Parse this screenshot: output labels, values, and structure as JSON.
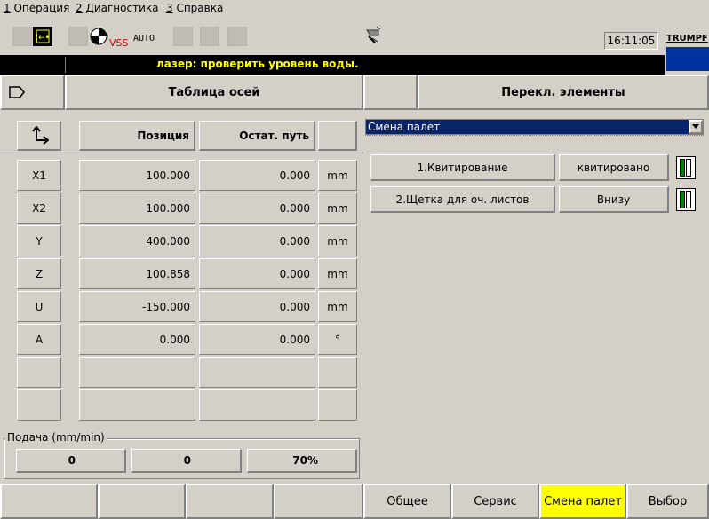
{
  "menu": {
    "items": [
      {
        "num": "1",
        "label": " Операция"
      },
      {
        "num": "2",
        "label": " Диагностика"
      },
      {
        "num": "3",
        "label": " Справка"
      }
    ]
  },
  "toolbar": {
    "vss_label": "VSS",
    "auto_label": "AUTO",
    "clock": "16:11:05",
    "brand": "TRUMPF",
    "message": "лазер: проверить уровень воды."
  },
  "left_panel": {
    "title": "Таблица осей",
    "col_position": "Позиция",
    "col_remaining": "Остат. путь",
    "axes": [
      {
        "name": "X1",
        "position": "100.000",
        "remaining": "0.000",
        "unit": "mm"
      },
      {
        "name": "X2",
        "position": "100.000",
        "remaining": "0.000",
        "unit": "mm"
      },
      {
        "name": "Y",
        "position": "400.000",
        "remaining": "0.000",
        "unit": "mm"
      },
      {
        "name": "Z",
        "position": "100.858",
        "remaining": "0.000",
        "unit": "mm"
      },
      {
        "name": "U",
        "position": "-150.000",
        "remaining": "0.000",
        "unit": "mm"
      },
      {
        "name": "A",
        "position": "0.000",
        "remaining": "0.000",
        "unit": "°"
      }
    ],
    "feed_label": "Подача (mm/min)",
    "feed_values": [
      "0",
      "0",
      "70%"
    ]
  },
  "right_panel": {
    "title": "Перекл. элементы",
    "dropdown_value": "Смена палет",
    "rows": [
      {
        "button": "1.Квитирование",
        "status": "квитировано"
      },
      {
        "button": "2.Щетка для оч. листов",
        "status": "Внизу"
      }
    ]
  },
  "bottom_tabs": [
    "Общее",
    "Сервис",
    "Смена палет",
    "Выбор"
  ],
  "colors": {
    "background": "#d4d0c8",
    "message_bar": "#000000",
    "message_text": "#ffff00",
    "dropdown_selected": "#0a246a",
    "active_tab": "#ffff00",
    "brand_box": "#0033a0"
  }
}
